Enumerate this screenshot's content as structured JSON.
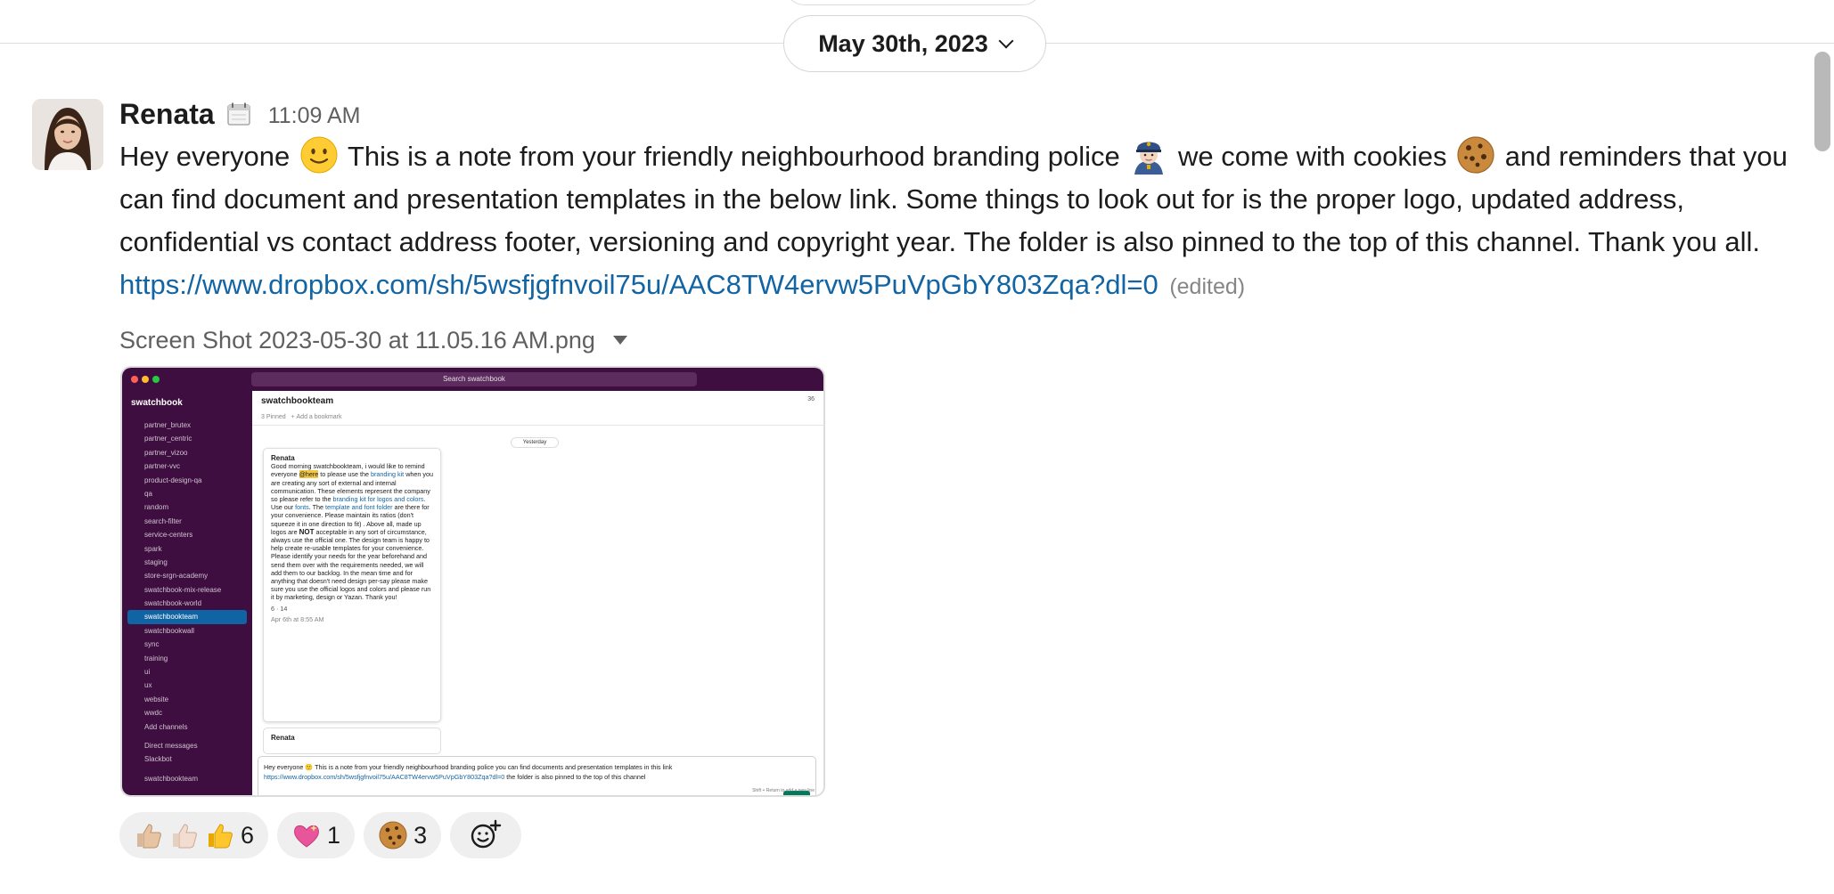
{
  "date_divider": {
    "label": "May 30th, 2023"
  },
  "message": {
    "author": "Renata",
    "time": "11:09 AM",
    "text_parts": {
      "p1": "Hey everyone",
      "p2": "This is a note from your friendly neighbourhood branding police",
      "p3": "we come with cookies",
      "p4": "and reminders that you can find document and presentation templates in the below link. Some things to look out for is the proper logo, updated address, confidential vs contact address footer, versioning and copyright year. The folder is also pinned to the top of this channel. Thank you all.",
      "link": "https://www.dropbox.com/sh/5wsfjgfnvoil75u/AAC8TW4ervw5PuVpGbY803Zqa?dl=0",
      "edited": "(edited)"
    },
    "attachment": {
      "filename": "Screen Shot 2023-05-30 at 11.05.16 AM.png",
      "mock": {
        "search": "Search swatchbook",
        "workspace": "swatchbook",
        "channels": [
          "partner_brutex",
          "partner_centric",
          "partner_vizoo",
          "partner-vvc",
          "product-design-qa",
          "qa",
          "random",
          "search-filter",
          "service-centers",
          "spark",
          "staging",
          "store-srgn-academy",
          "swatchbook-mix-release",
          "swatchbook-world",
          "swatchbookteam",
          "swatchbookwall",
          "sync",
          "training",
          "ui",
          "ux",
          "website",
          "wwdc"
        ],
        "active_channel": "swatchbookteam",
        "add_channels": "Add channels",
        "direct_messages": "Direct messages",
        "slackbot": "Slackbot",
        "footer_ws": "swatchbookteam",
        "channel_title": "swatchbookteam",
        "member_count": "36",
        "pinned": "3 Pinned",
        "add_bookmark": "Add a bookmark",
        "day_divider": "Yesterday",
        "card_author": "Renata",
        "card_text_a": "Good morning swatchbookteam, i would like to remind everyone",
        "card_mention": "@here",
        "card_text_b": "to please use the",
        "card_link1": "branding kit",
        "card_text_c": "when you are creating any sort of external and internal communication. These elements represent the company so please refer to the",
        "card_link2": "branding kit for logos and colors",
        "card_text_d": ". Use our",
        "card_link3": "fonts",
        "card_text_e": ". The",
        "card_link4": "template and font folder",
        "card_text_f": "are there for your convenience. Please maintain its ratios (don't squeeze it in one direction to fit) . Above all, made up logos are",
        "card_not": "NOT",
        "card_text_g": "acceptable in any sort of circumstance, always use the official one. The design team is happy to help create re-usable templates for your convenience. Please identify your needs for the year beforehand and send them over with the requirements needed, we will add them to our backlog. In the mean time and for anything that doesn't need design per-say please make sure you use the official logos and colors and please run it by marketing, design or Yazan. Thank you!",
        "card_reacts": "6 · 14",
        "card_date": "Apr 6th at 8:55 AM",
        "card2_author": "Renata",
        "compose_text": "Hey everyone 🙂 This is a note from your friendly neighbourhood branding police you can find documents and presentation templates in this link",
        "compose_link": "https://www.dropbox.com/sh/5wsfjgfnvoil75u/AAC8TW4ervw5PuVpGbY803Zqa?dl=0",
        "compose_tail": "the folder is also pinned to the top of this channel",
        "compose_hint": "Shift + Return to add a new line"
      }
    },
    "reactions": [
      {
        "emoji": "thumbs-up-skin-tones",
        "count": "6"
      },
      {
        "emoji": "sparkling-heart",
        "count": "1"
      },
      {
        "emoji": "cookie",
        "count": "3"
      }
    ]
  },
  "colors": {
    "link": "#1264a3",
    "sidebar": "#3f0e40",
    "active": "#1164a3",
    "reaction_bg": "#efefef"
  }
}
